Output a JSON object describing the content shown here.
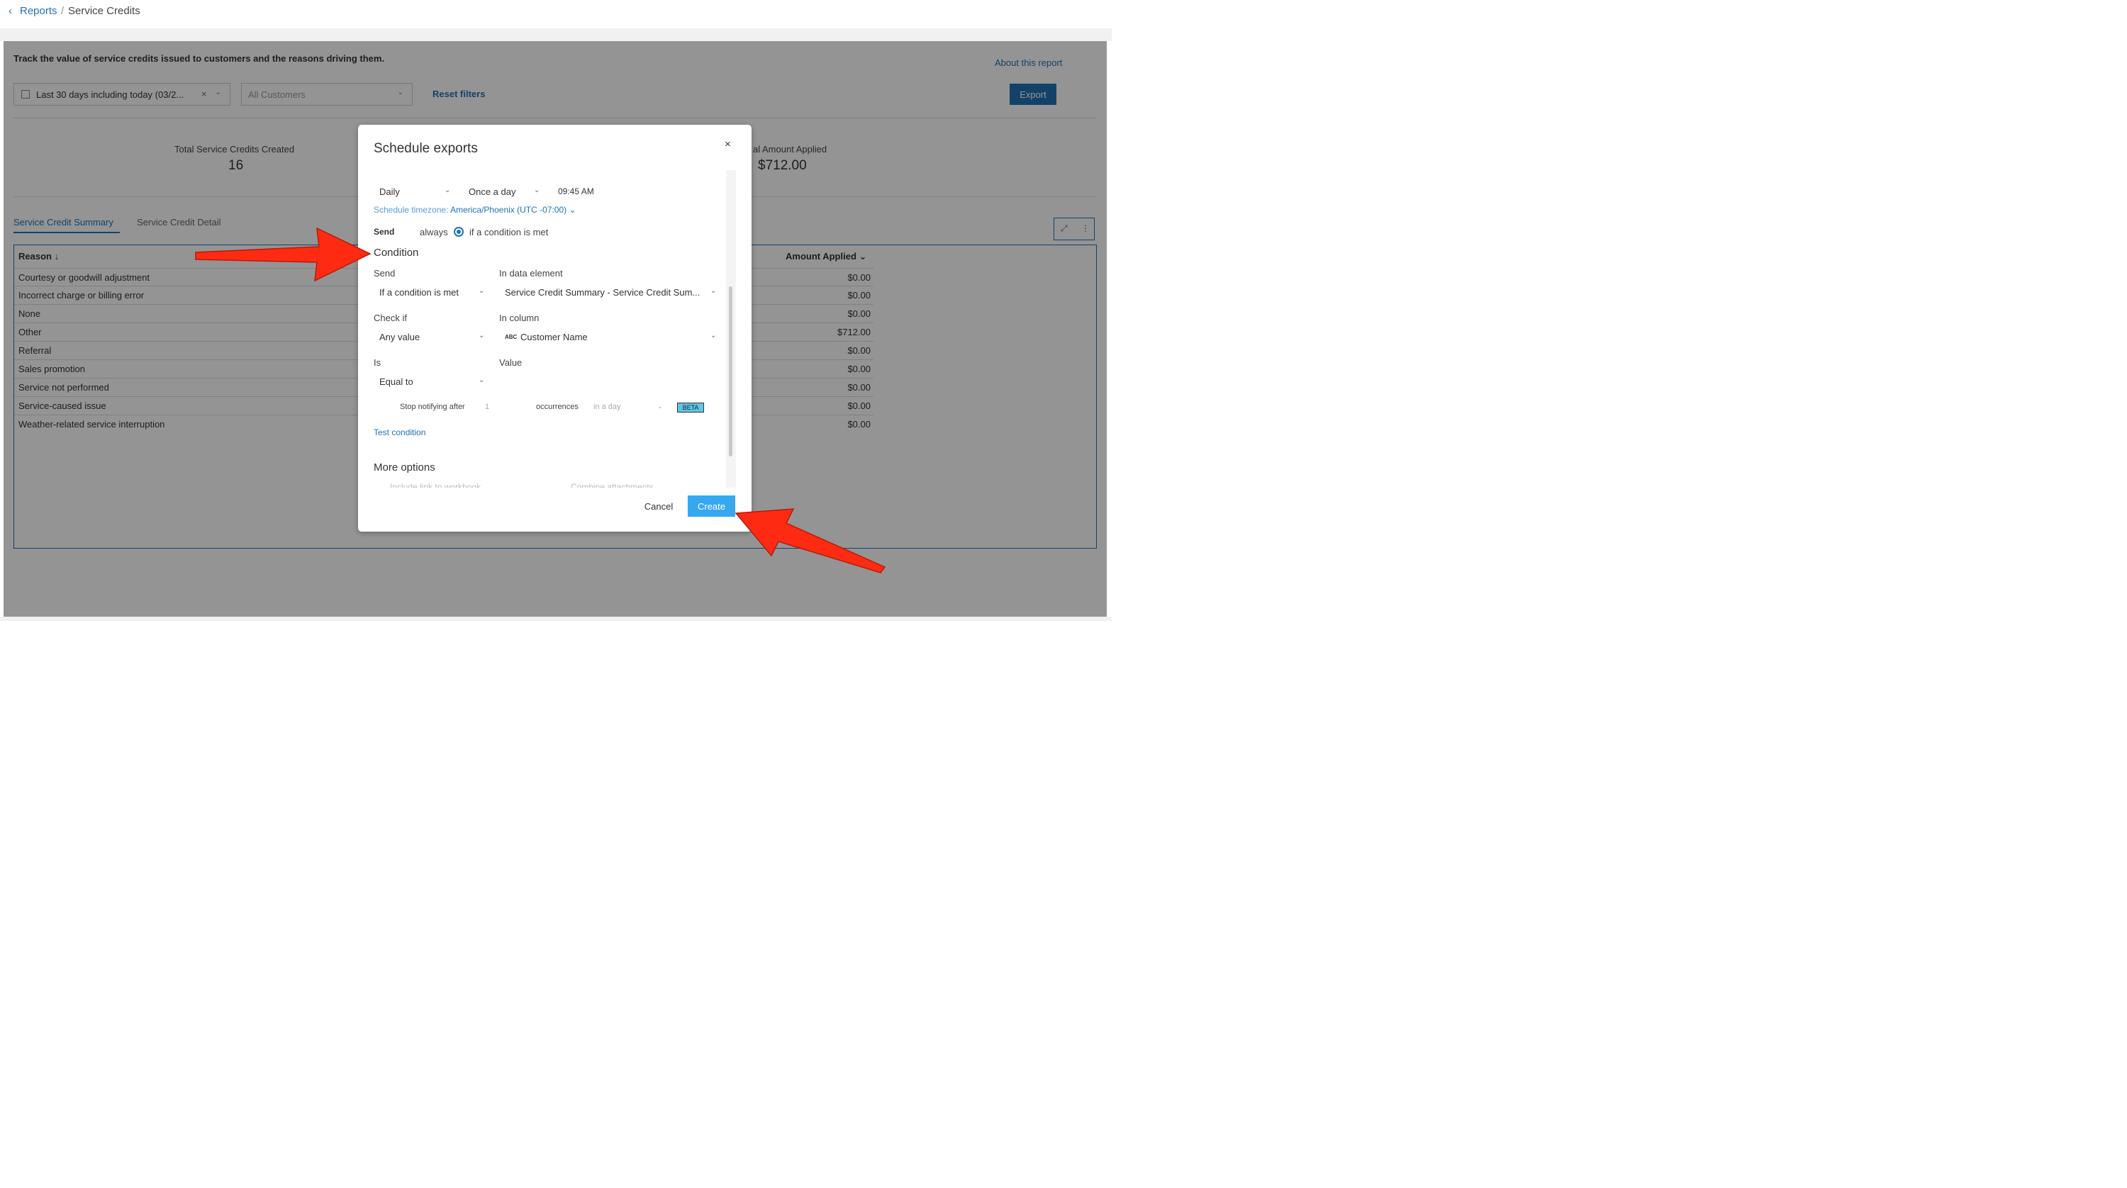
{
  "breadcrumb": {
    "back_icon": "chevron-left-icon",
    "parent": "Reports",
    "separator": "/",
    "current": "Service Credits"
  },
  "header": {
    "description": "Track the value of service credits issued to customers and the reasons driving them.",
    "about_link": "About this report",
    "export_label": "Export"
  },
  "filters": {
    "date_value": "Last 30 days including today (03/2...",
    "date_clear": "×",
    "customers_placeholder": "All Customers",
    "reset_label": "Reset filters"
  },
  "kpis": [
    {
      "label": "Total Service Credits Created",
      "value": "16"
    },
    {
      "label": "al Amount Applied",
      "value": "$712.00"
    }
  ],
  "tabs": {
    "summary": "Service Credit Summary",
    "detail": "Service Credit Detail"
  },
  "table": {
    "col_reason": "Reason ↓",
    "col_amount": "Amount Applied ⌄",
    "rows": [
      {
        "reason": "Courtesy or goodwill adjustment",
        "amount": "$0.00"
      },
      {
        "reason": "Incorrect charge or billing error",
        "amount": "$0.00"
      },
      {
        "reason": "None",
        "amount": "$0.00"
      },
      {
        "reason": "Other",
        "amount": "$712.00"
      },
      {
        "reason": "Referral",
        "amount": "$0.00"
      },
      {
        "reason": "Sales promotion",
        "amount": "$0.00"
      },
      {
        "reason": "Service not performed",
        "amount": "$0.00"
      },
      {
        "reason": "Service-caused issue",
        "amount": "$0.00"
      },
      {
        "reason": "Weather-related service interruption",
        "amount": "$0.00"
      }
    ],
    "expand_icon": "expand-icon",
    "more_icon": "more-vertical-icon"
  },
  "modal": {
    "title": "Schedule exports",
    "close": "×",
    "frequency": "Daily",
    "occurrence": "Once a day",
    "time": "09:45 AM",
    "timezone_label": "Schedule timezone:",
    "timezone_value": "America/Phoenix (UTC -07:00)",
    "send_label": "Send",
    "send_always": "always",
    "send_condition": "if a condition is met",
    "condition_heading": "Condition",
    "cond_send_label": "Send",
    "cond_send_value": "If a condition is met",
    "data_element_label": "In data element",
    "data_element_value": "Service Credit Summary - Service Credit Sum...",
    "check_if_label": "Check if",
    "check_if_value": "Any value",
    "column_label": "In column",
    "column_type": "ABC",
    "column_value": "Customer Name",
    "is_label": "Is",
    "is_value": "Equal to",
    "value_label": "Value",
    "stop_label": "Stop notifying after",
    "stop_count": "1",
    "occurrences_label": "occurrences",
    "per_period": "in a day",
    "beta": "BETA",
    "test_link": "Test condition",
    "more_options": "More options",
    "opt_link": "Include link to workbook",
    "opt_combine": "Combine attachments",
    "cancel_label": "Cancel",
    "create_label": "Create"
  },
  "annotation_color": "#ff2a12",
  "accent": "#1f73b7"
}
